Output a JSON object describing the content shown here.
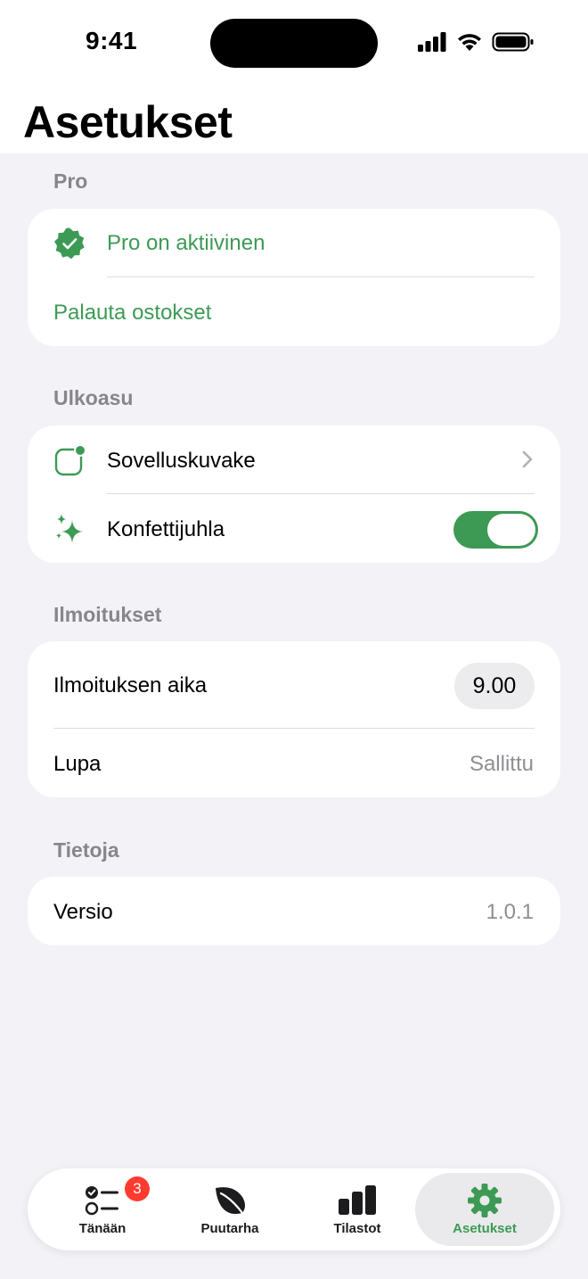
{
  "status_bar": {
    "time": "9:41"
  },
  "page_title": "Asetukset",
  "sections": {
    "pro": {
      "header": "Pro",
      "active_label": "Pro on aktiivinen",
      "restore_label": "Palauta ostokset"
    },
    "appearance": {
      "header": "Ulkoasu",
      "app_icon_label": "Sovelluskuvake",
      "confetti_label": "Konfettijuhla",
      "confetti_enabled": true
    },
    "notifications": {
      "header": "Ilmoitukset",
      "time_label": "Ilmoituksen aika",
      "time_value": "9.00",
      "permission_label": "Lupa",
      "permission_value": "Sallittu"
    },
    "about": {
      "header": "Tietoja",
      "version_label": "Versio",
      "version_value": "1.0.1"
    }
  },
  "tabbar": {
    "tabs": [
      {
        "label": "Tänään",
        "icon": "checklist-icon",
        "badge": "3"
      },
      {
        "label": "Puutarha",
        "icon": "leaf-icon"
      },
      {
        "label": "Tilastot",
        "icon": "bar-chart-icon"
      },
      {
        "label": "Asetukset",
        "icon": "gear-icon",
        "active": true
      }
    ]
  },
  "colors": {
    "accent": "#3d9a55",
    "background": "#f2f2f7",
    "badge": "#ff3b30"
  }
}
